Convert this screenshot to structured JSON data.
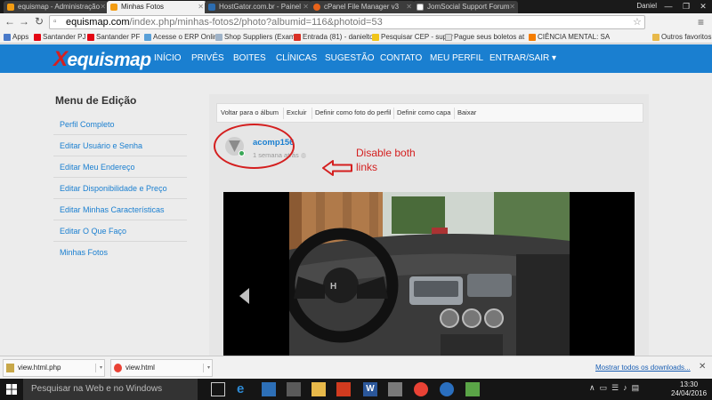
{
  "browser": {
    "tabs": [
      {
        "label": "equismap - Administração",
        "active": false,
        "favicon": "joomla-favicon"
      },
      {
        "label": "Minhas Fotos",
        "active": true,
        "favicon": "joomla-favicon"
      },
      {
        "label": "HostGator.com.br - Painel",
        "active": false,
        "favicon": "hostgator-favicon"
      },
      {
        "label": "cPanel File Manager v3",
        "active": false,
        "favicon": "cpanel-favicon"
      },
      {
        "label": "JomSocial Support Forum",
        "active": false,
        "favicon": "jomsocial-favicon"
      }
    ],
    "profile_name": "Daniel",
    "url_host": "equismap.com",
    "url_path": "/index.php/minhas-fotos2/photo?albumid=116&photoid=53",
    "bookmarks": [
      {
        "label": "Apps",
        "icon": "apps-icon"
      },
      {
        "label": "Santander PJ",
        "icon": "santander-icon"
      },
      {
        "label": "Santander PF",
        "icon": "santander-icon"
      },
      {
        "label": "Acesse o ERP Online",
        "icon": "erp-icon"
      },
      {
        "label": "Shop Suppliers (Exam",
        "icon": "shop-icon"
      },
      {
        "label": "Entrada (81) - danielto",
        "icon": "gmail-icon"
      },
      {
        "label": "Pesquisar CEP - super",
        "icon": "cep-icon"
      },
      {
        "label": "Pague seus boletos at",
        "icon": "page-icon"
      },
      {
        "label": "CIÊNCIA MENTAL: SA",
        "icon": "blogger-icon"
      },
      {
        "label": "Outros favoritos",
        "icon": "folder-icon"
      }
    ]
  },
  "site": {
    "logo_x": "X",
    "logo_text": "equismap",
    "nav": [
      "INÍCIO",
      "PRIVÊS",
      "BOITES",
      "CLÍNICAS",
      "SUGESTÃO",
      "CONTATO",
      "MEU PERFIL",
      "ENTRAR/SAIR ▾"
    ]
  },
  "sidebar": {
    "title": "Menu de Edição",
    "items": [
      "Perfil Completo",
      "Editar Usuário e Senha",
      "Editar Meu Endereço",
      "Editar Disponibilidade e Preço",
      "Editar Minhas Características",
      "Editar O Que Faço",
      "Minhas Fotos"
    ]
  },
  "photo_toolbar": {
    "buttons": [
      "Voltar para o álbum",
      "Excluir",
      "Definir como foto do perfil",
      "Definir como capa",
      "Baixar"
    ]
  },
  "author": {
    "name": "acomp156",
    "time": "1 semana atrás",
    "status_color": "#3aa757"
  },
  "annotation": {
    "text": "Disable both links",
    "color": "#d41f1f"
  },
  "downloads": {
    "items": [
      "view.html.php",
      "view.html"
    ],
    "show_all": "Mostrar todos os downloads..."
  },
  "taskbar": {
    "search_placeholder": "Pesquisar na Web e no Windows",
    "time": "13:30",
    "date": "24/04/2016"
  },
  "colors": {
    "brand": "#1a7fd0",
    "annotation": "#d41f1f"
  }
}
